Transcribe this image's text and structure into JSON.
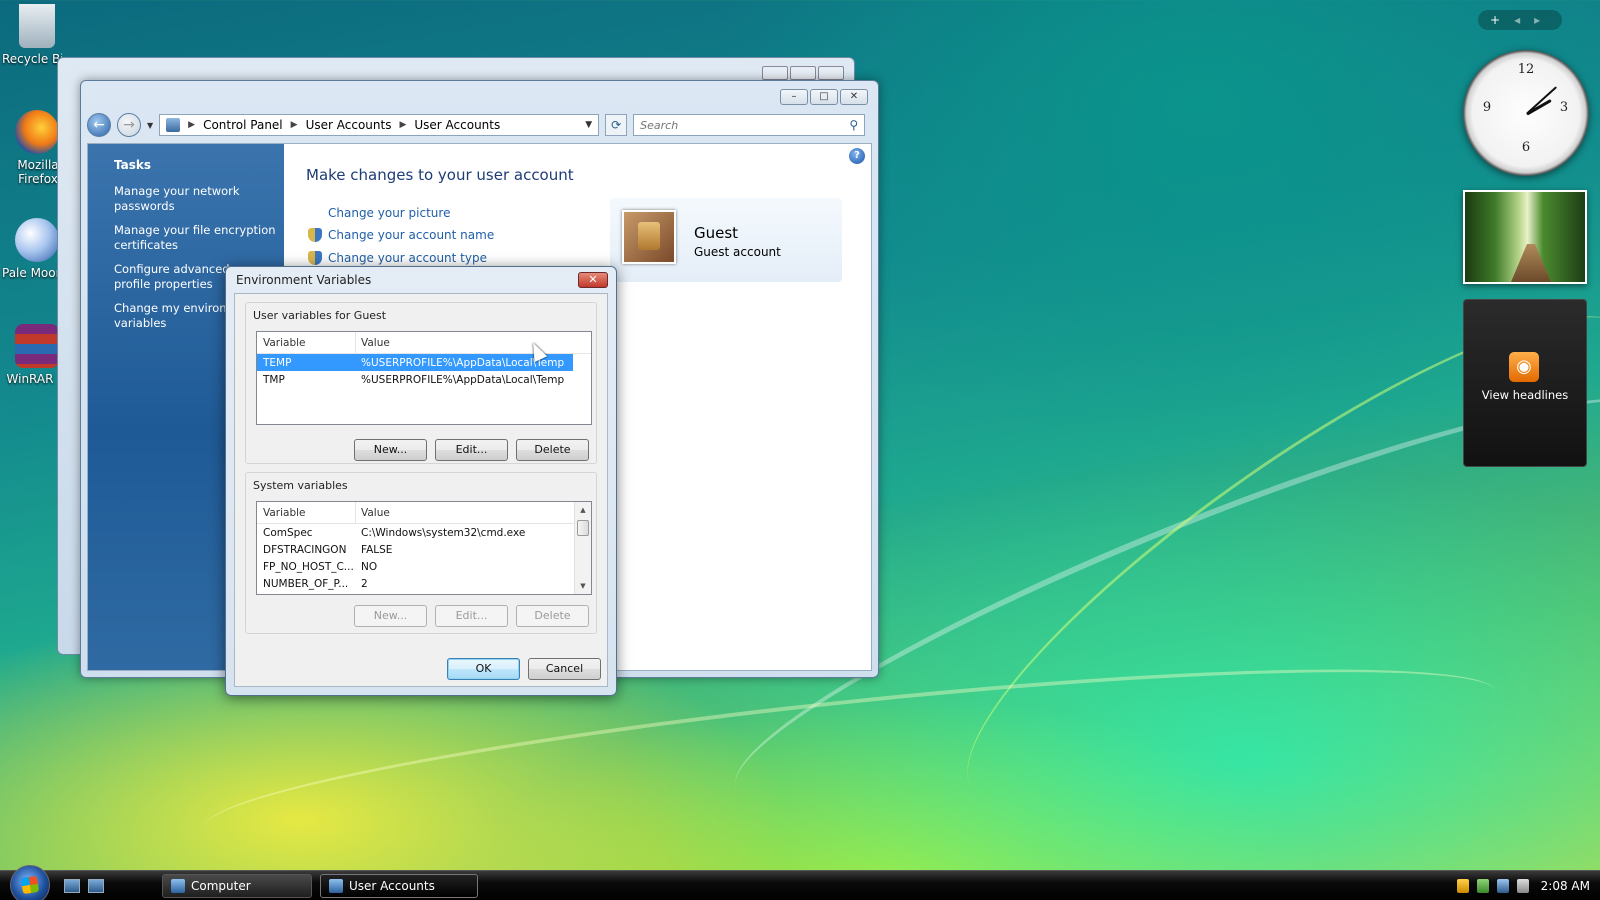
{
  "desktop": {
    "icons": [
      {
        "label": "Recycle Bin",
        "icon": "recycle-bin-icon"
      },
      {
        "label": "Mozilla Firefox",
        "icon": "firefox-icon"
      },
      {
        "label": "Pale Moon",
        "icon": "pale-moon-icon"
      },
      {
        "label": "WinRAR",
        "icon": "winrar-icon"
      }
    ]
  },
  "window": {
    "breadcrumb": [
      "Control Panel",
      "User Accounts",
      "User Accounts"
    ],
    "search_placeholder": "Search",
    "tasks_title": "Tasks",
    "tasks": [
      "Manage your network passwords",
      "Manage your file encryption certificates",
      "Configure advanced user profile properties",
      "Change my environment variables"
    ],
    "heading": "Make changes to your user account",
    "links": [
      "Change your picture",
      "Change your account name",
      "Change your account type"
    ],
    "user": {
      "name": "Guest",
      "type": "Guest account"
    }
  },
  "dialog": {
    "title": "Environment Variables",
    "close_label": "✕",
    "user_group_label": "User variables for Guest",
    "system_group_label": "System variables",
    "columns": {
      "variable": "Variable",
      "value": "Value"
    },
    "user_vars": [
      {
        "variable": "TEMP",
        "value": "%USERPROFILE%\\AppData\\Local\\Temp",
        "selected": true
      },
      {
        "variable": "TMP",
        "value": "%USERPROFILE%\\AppData\\Local\\Temp",
        "selected": false
      }
    ],
    "system_vars": [
      {
        "variable": "ComSpec",
        "value": "C:\\Windows\\system32\\cmd.exe"
      },
      {
        "variable": "DFSTRACINGON",
        "value": "FALSE"
      },
      {
        "variable": "FP_NO_HOST_C...",
        "value": "NO"
      },
      {
        "variable": "NUMBER_OF_P...",
        "value": "2"
      }
    ],
    "buttons": {
      "new": "New...",
      "edit": "Edit...",
      "delete": "Delete",
      "ok": "OK",
      "cancel": "Cancel"
    }
  },
  "gadgets": {
    "feeds_label": "View headlines"
  },
  "taskbar": {
    "items": [
      {
        "label": "Computer",
        "active": false
      },
      {
        "label": "User Accounts",
        "active": true
      }
    ],
    "clock": "2:08 AM"
  },
  "colors": {
    "selection": "#3399ff",
    "link": "#1f5fa8",
    "tasks_pane": "#1e5a96"
  }
}
